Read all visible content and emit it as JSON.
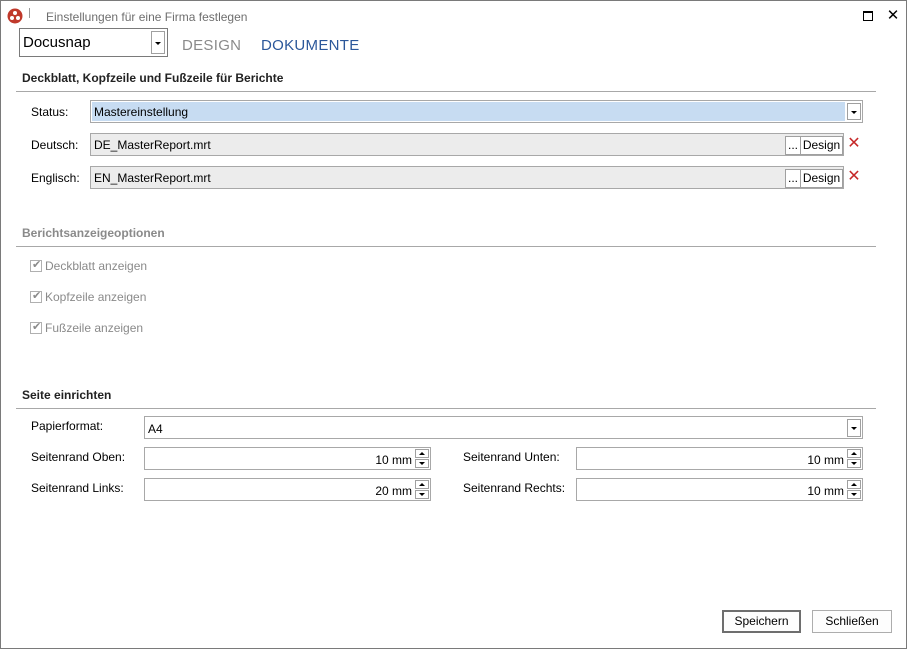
{
  "window": {
    "title": "Einstellungen für eine Firma festlegen",
    "app_icon": "docusnap-logo-icon",
    "maximize_icon": "maximize-icon",
    "close_glyph": "✕"
  },
  "company": {
    "value": "Docusnap"
  },
  "tabs": [
    {
      "label": "DESIGN",
      "active": false
    },
    {
      "label": "DOKUMENTE",
      "active": true
    }
  ],
  "report_section": {
    "title": "Deckblatt, Kopfzeile und Fußzeile für Berichte",
    "status_label": "Status:",
    "status_value": "Mastereinstellung",
    "german_label": "Deutsch:",
    "german_file": "DE_MasterReport.mrt",
    "english_label": "Englisch:",
    "english_file": "EN_MasterReport.mrt",
    "browse_label": "...",
    "design_label": "Design",
    "remove_glyph": "✕"
  },
  "display_section": {
    "title": "Berichtsanzeigeoptionen",
    "options": [
      {
        "label": "Deckblatt anzeigen",
        "checked": true
      },
      {
        "label": "Kopfzeile anzeigen",
        "checked": true
      },
      {
        "label": "Fußzeile anzeigen",
        "checked": true
      }
    ]
  },
  "page_section": {
    "title": "Seite einrichten",
    "paper_label": "Papierformat:",
    "paper_value": "A4",
    "margin_top_label": "Seitenrand Oben:",
    "margin_top_value": "10 mm",
    "margin_bottom_label": "Seitenrand Unten:",
    "margin_bottom_value": "10 mm",
    "margin_left_label": "Seitenrand Links:",
    "margin_left_value": "20 mm",
    "margin_right_label": "Seitenrand Rechts:",
    "margin_right_value": "10 mm"
  },
  "footer": {
    "save_label": "Speichern",
    "close_label": "Schließen"
  },
  "colors": {
    "accent_tab": "#2b579a",
    "status_highlight": "#c7dcf2",
    "remove_red": "#c62828"
  }
}
